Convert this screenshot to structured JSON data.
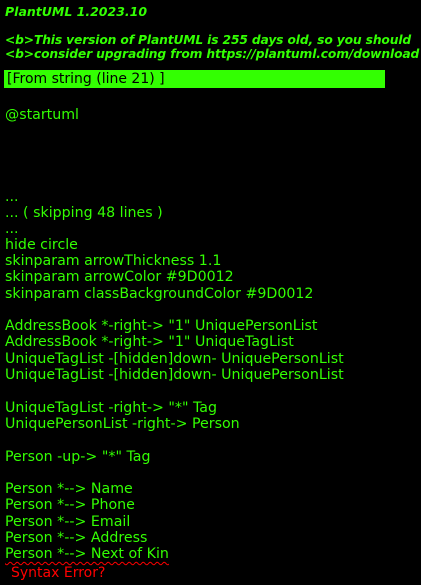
{
  "colors": {
    "background": "#000000",
    "text": "#33ff02",
    "error": "#ff0000"
  },
  "header": {
    "title": "PlantUML 1.2023.10",
    "warning_line1": "<b>This version of PlantUML is 255 days old, so you should",
    "warning_line2": "<b>consider upgrading from https://plantuml.com/download"
  },
  "source_label": "[From string (line 21) ]",
  "lines": [
    "@startuml",
    "...",
    "... ( skipping 48 lines )",
    "...",
    "hide circle",
    "skinparam arrowThickness 1.1",
    "skinparam arrowColor #9D0012",
    "skinparam classBackgroundColor #9D0012",
    "AddressBook *-right-> \"1\" UniquePersonList",
    "AddressBook *-right-> \"1\" UniqueTagList",
    "UniqueTagList -[hidden]down- UniquePersonList",
    "UniqueTagList -[hidden]down- UniquePersonList",
    "UniqueTagList -right-> \"*\" Tag",
    "UniquePersonList -right-> Person",
    "Person -up-> \"*\" Tag",
    "Person *--> Name",
    "Person *--> Phone",
    "Person *--> Email",
    "Person *--> Address",
    "Person *--> Next of Kin"
  ],
  "error_message": "Syntax Error?"
}
